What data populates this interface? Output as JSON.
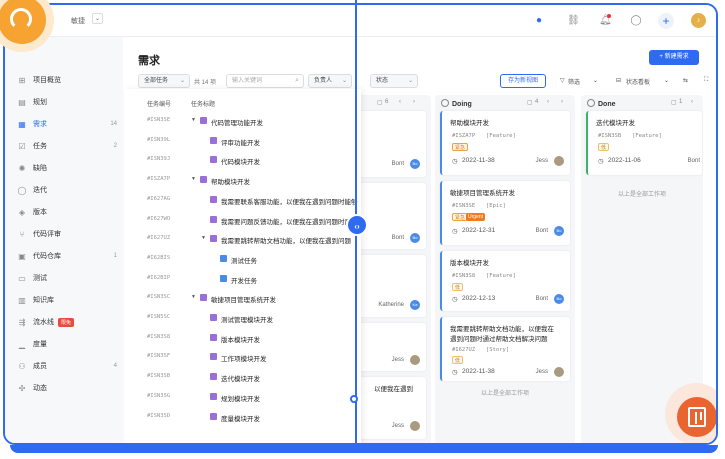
{
  "topbar": {
    "workspace": "敏捷"
  },
  "sidebar": {
    "items": [
      {
        "label": "项目概览",
        "icon": "overview-icon",
        "count": ""
      },
      {
        "label": "规划",
        "icon": "plan-icon",
        "count": ""
      },
      {
        "label": "需求",
        "icon": "requirement-icon",
        "count": "14",
        "active": true
      },
      {
        "label": "任务",
        "icon": "task-icon",
        "count": "2"
      },
      {
        "label": "缺陷",
        "icon": "bug-icon",
        "count": ""
      },
      {
        "label": "迭代",
        "icon": "iteration-icon",
        "count": ""
      },
      {
        "label": "版本",
        "icon": "version-icon",
        "count": ""
      },
      {
        "label": "代码评审",
        "icon": "code-review-icon",
        "count": ""
      },
      {
        "label": "代码仓库",
        "icon": "repo-icon",
        "count": "1"
      },
      {
        "label": "测试",
        "icon": "test-icon",
        "count": ""
      },
      {
        "label": "知识库",
        "icon": "wiki-icon",
        "count": ""
      },
      {
        "label": "流水线",
        "icon": "pipeline-icon",
        "count": "",
        "badge": "限免"
      },
      {
        "label": "度量",
        "icon": "metrics-icon",
        "count": ""
      },
      {
        "label": "成员",
        "icon": "members-icon",
        "count": "4"
      },
      {
        "label": "动态",
        "icon": "activity-icon",
        "count": ""
      }
    ]
  },
  "main": {
    "title": "需求",
    "new_button": "+ 新建需求",
    "filters": {
      "all_tasks": "全部任务",
      "count": "共 14 项",
      "search_placeholder": "输入关键词",
      "assignee": "负责人",
      "status": "状态",
      "save_view": "存为新视图",
      "filter": "筛选",
      "view": "状态看板"
    }
  },
  "tree": {
    "col_num": "任务编号",
    "col_title": "任务标题",
    "rows": [
      {
        "num": "#ISN3SE",
        "label": "代码管理功能开发",
        "level": 0,
        "type": "purple",
        "expand": true
      },
      {
        "num": "#ISN39L",
        "label": "评审功能开发",
        "level": 1,
        "type": "purple"
      },
      {
        "num": "#ISN39J",
        "label": "代码模块开发",
        "level": 1,
        "type": "purple"
      },
      {
        "num": "#ISZA7P",
        "label": "帮助模块开发",
        "level": 0,
        "type": "purple",
        "expand": true
      },
      {
        "num": "#I627AG",
        "label": "我需要联系客服功能，以便我在遇到问题时能够",
        "level": 1,
        "type": "purple"
      },
      {
        "num": "#I627WO",
        "label": "我需要问题反馈功能，以便我在遇到问题时反馈",
        "level": 1,
        "type": "purple"
      },
      {
        "num": "#I627UZ",
        "label": "我需要跳转帮助文档功能，以便我在遇到问题",
        "level": 1,
        "type": "purple",
        "expand": true
      },
      {
        "num": "#I62BIS",
        "label": "测试任务",
        "level": 2,
        "type": "blue"
      },
      {
        "num": "#I62BIP",
        "label": "开发任务",
        "level": 2,
        "type": "blue"
      },
      {
        "num": "#ISN3SC",
        "label": "敏捷项目管理系统开发",
        "level": 0,
        "type": "purple",
        "expand": true
      },
      {
        "num": "#ISN5SC",
        "label": "测试管理模块开发",
        "level": 1,
        "type": "purple"
      },
      {
        "num": "#ISN3S8",
        "label": "版本模块开发",
        "level": 1,
        "type": "purple"
      },
      {
        "num": "#ISN3SF",
        "label": "工作项模块开发",
        "level": 1,
        "type": "purple"
      },
      {
        "num": "#ISN3SB",
        "label": "迭代模块开发",
        "level": 1,
        "type": "purple"
      },
      {
        "num": "#ISN3SG",
        "label": "规划模块开发",
        "level": 1,
        "type": "purple"
      },
      {
        "num": "#ISN3SD",
        "label": "度量模块开发",
        "level": 1,
        "type": "purple"
      }
    ]
  },
  "columns": {
    "partial": {
      "count": "6",
      "cards": [
        {
          "owner": "Bont",
          "avatar": "Bo"
        },
        {
          "owner": "Bont",
          "avatar": "Bo"
        },
        {
          "owner": "Katherine",
          "avatar": "Ka"
        },
        {
          "owner": "Jess",
          "avatar": ""
        },
        {
          "title": "以便我在遇到",
          "owner": "Jess",
          "avatar": ""
        }
      ]
    },
    "doing": {
      "name": "Doing",
      "count": "4",
      "cards": [
        {
          "title": "帮助模块开发",
          "num": "#ISZA7P",
          "type": "[Feature]",
          "tags": [
            {
              "t": "紧急",
              "c": "urgent"
            }
          ],
          "date": "2022-11-38",
          "owner": "Jess",
          "avatar": ""
        },
        {
          "title": "敏捷项目管理系统开发",
          "num": "#ISN3SE",
          "type": "[Epic]",
          "tags": [
            {
              "t": "紧急",
              "c": "urgent"
            },
            {
              "t": "Urgent",
              "c": "orange"
            }
          ],
          "date": "2022-12-31",
          "owner": "Bont",
          "avatar": "Bo"
        },
        {
          "title": "版本模块开发",
          "num": "#ISN3S8",
          "type": "[Feature]",
          "tags": [
            {
              "t": "低",
              "c": "low"
            }
          ],
          "date": "2022-12-13",
          "owner": "Bont",
          "avatar": "Bo"
        },
        {
          "title": "我需要跳转帮助文档功能，以便我在遇到问题时通过帮助文档解决问题",
          "num": "#I627UZ",
          "type": "[Story]",
          "tags": [
            {
              "t": "低",
              "c": "low"
            }
          ],
          "date": "2022-11-38",
          "owner": "Jess",
          "avatar": ""
        }
      ],
      "footer": "以上是全部工作项"
    },
    "done": {
      "name": "Done",
      "count": "1",
      "cards": [
        {
          "title": "迭代模块开发",
          "num": "#ISN3SB",
          "type": "[Feature]",
          "tags": [
            {
              "t": "低",
              "c": "low"
            }
          ],
          "date": "2022-11-06",
          "owner": "Bont",
          "avatar": "Bo"
        }
      ],
      "footer": "以上是全部工作项"
    }
  }
}
